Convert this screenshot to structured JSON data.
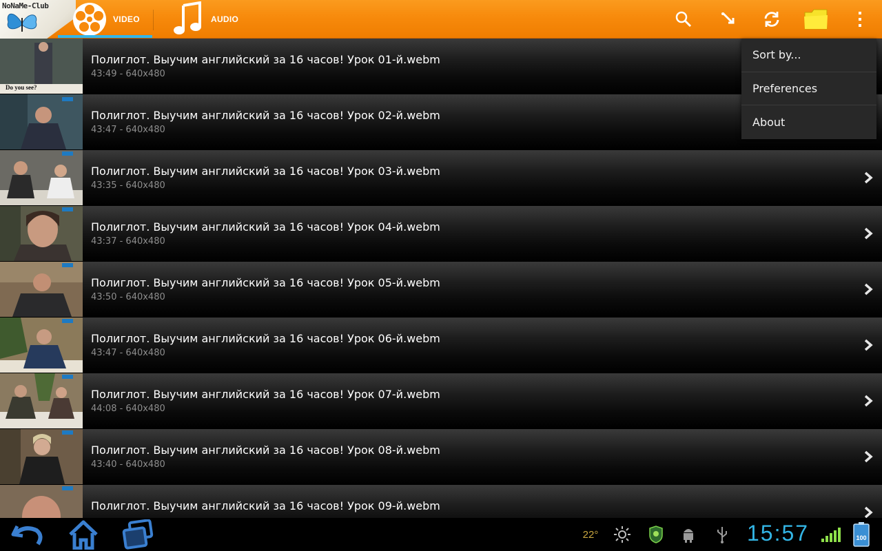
{
  "app": {
    "logo_text": "NoNaMe-Club",
    "tabs": [
      {
        "label": "VIDEO",
        "selected": true
      },
      {
        "label": "AUDIO",
        "selected": false
      }
    ],
    "actions": [
      "search-icon",
      "pin-icon",
      "refresh-icon",
      "folder-icon",
      "overflow-menu-icon"
    ],
    "colors": {
      "accent": "#31b5ea",
      "bar": "#f78a0c"
    }
  },
  "menu": {
    "items": [
      "Sort by...",
      "Preferences",
      "About"
    ]
  },
  "videos": [
    {
      "title": "Полиглот. Выучим английский за 16 часов! Урок 01-й.webm",
      "meta": "43:49 - 640x480",
      "thumb_caption": "Do you see?"
    },
    {
      "title": "Полиглот. Выучим английский за 16 часов! Урок 02-й.webm",
      "meta": "43:47 - 640x480"
    },
    {
      "title": "Полиглот. Выучим английский за 16 часов! Урок 03-й.webm",
      "meta": "43:35 - 640x480"
    },
    {
      "title": "Полиглот. Выучим английский за 16 часов! Урок 04-й.webm",
      "meta": "43:37 - 640x480"
    },
    {
      "title": "Полиглот. Выучим английский за 16 часов! Урок 05-й.webm",
      "meta": "43:50 - 640x480"
    },
    {
      "title": "Полиглот. Выучим английский за 16 часов! Урок 06-й.webm",
      "meta": "43:47 - 640x480"
    },
    {
      "title": "Полиглот. Выучим английский за 16 часов! Урок 07-й.webm",
      "meta": "44:08 - 640x480"
    },
    {
      "title": "Полиглот. Выучим английский за 16 часов! Урок 08-й.webm",
      "meta": "43:40 - 640x480"
    },
    {
      "title": "Полиглот. Выучим английский за 16 часов! Урок 09-й.webm",
      "meta": ""
    }
  ],
  "system": {
    "nav": [
      "back-icon",
      "home-icon",
      "recent-apps-icon"
    ],
    "temperature": "22°",
    "clock": "15:57",
    "battery": "100",
    "status_icons": [
      "brightness-icon",
      "shield-icon",
      "android-debug-icon",
      "usb-icon",
      "signal-icon",
      "battery-icon"
    ]
  }
}
